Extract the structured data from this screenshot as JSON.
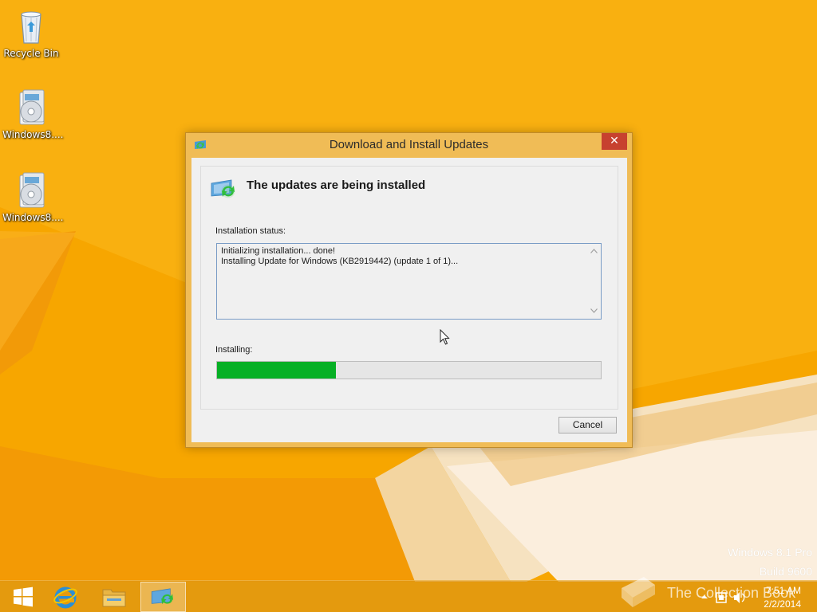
{
  "desktop": {
    "icons": [
      {
        "label": "Recycle Bin",
        "icon": "recycle-bin-icon"
      },
      {
        "label": "Windows8....",
        "icon": "disc-image-icon"
      },
      {
        "label": "Windows8....",
        "icon": "disc-image-icon"
      }
    ],
    "watermark": {
      "edition": "Windows 8.1 Pro",
      "build": "Build 9600"
    }
  },
  "dialog": {
    "title": "Download and Install Updates",
    "close_glyph": "✕",
    "heading": "The updates are being installed",
    "status_label": "Installation status:",
    "log_lines": [
      "Initializing installation... done!",
      "Installing Update for Windows (KB2919442) (update 1 of 1)..."
    ],
    "progress_label": "Installing:",
    "progress_fraction": 0.31,
    "cancel_label": "Cancel"
  },
  "taskbar": {
    "buttons": [
      {
        "name": "start-button",
        "icon": "windows-logo-icon"
      },
      {
        "name": "internet-explorer-button",
        "icon": "internet-explorer-icon"
      },
      {
        "name": "file-explorer-button",
        "icon": "folder-icon"
      },
      {
        "name": "windows-update-button",
        "icon": "windows-update-icon",
        "active": true
      }
    ],
    "overlay_text": "The Collection Book",
    "clock": {
      "time": "7:51 AM",
      "date": "2/2/2014"
    }
  },
  "colors": {
    "wallpaper": "#f6a400",
    "dialog_frame": "#f0bc56",
    "close_button": "#c7412f",
    "progress_fill": "#06b025"
  }
}
